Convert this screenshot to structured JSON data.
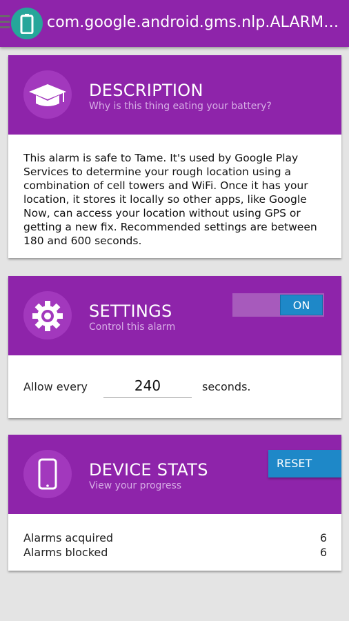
{
  "appbar": {
    "title": "com.google.android.gms.nlp.ALARM_WAKEUP_LOCATOR",
    "menu_icon": "menu-icon",
    "app_icon": "battery-icon",
    "color": "#8e24aa",
    "logo_color": "#26a69a"
  },
  "description": {
    "title": "DESCRIPTION",
    "subtitle": "Why is this thing eating your battery?",
    "icon": "graduation-cap-icon",
    "body": "This alarm is safe to Tame. It's used by Google Play Services to determine your rough location using a combination of cell towers and WiFi. Once it has your location, it stores it locally so other apps, like Google Now, can access your location without using GPS or getting a new fix. Recommended settings are between 180 and 600 seconds."
  },
  "settings": {
    "title": "SETTINGS",
    "subtitle": "Control this alarm",
    "icon": "gear-icon",
    "toggle_label": "ON",
    "allow_label": "Allow every",
    "interval_value": "240",
    "unit_label": "seconds."
  },
  "stats": {
    "title": "DEVICE STATS",
    "subtitle": "View your progress",
    "icon": "phone-icon",
    "reset_label": "RESET",
    "rows": [
      {
        "label": "Alarms acquired",
        "value": "6"
      },
      {
        "label": "Alarms blocked",
        "value": "6"
      }
    ]
  },
  "colors": {
    "header_purple": "#8e24aa",
    "accent_blue": "#1e88c8",
    "background": "#e4e4e4"
  }
}
